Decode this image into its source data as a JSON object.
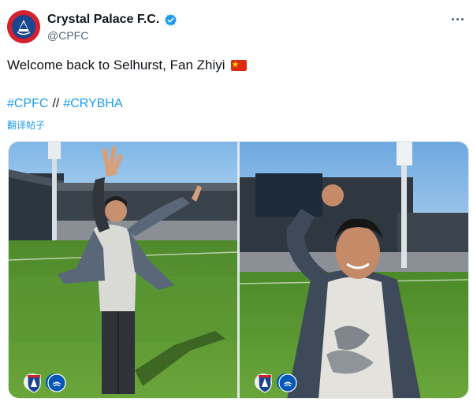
{
  "account": {
    "display_name": "Crystal Palace F.C.",
    "handle": "@CPFC",
    "avatar_icon": "crystal-palace-crest-icon",
    "verified_icon": "verified-badge-icon",
    "verified_color": "#1d9bf0"
  },
  "menu": {
    "more_icon": "more-options-icon"
  },
  "tweet": {
    "text": "Welcome back to Selhurst, Fan Zhiyi",
    "emoji_icon": "china-flag-icon",
    "hashtags": [
      "#CPFC",
      "#CRYBHA"
    ],
    "separator": "//",
    "translate_label": "翻译帖子"
  },
  "media": {
    "photos": [
      {
        "icon": "photo-fan-zhiyi-arms-raised",
        "badges": [
          "crystal-palace-badge-icon",
          "brighton-badge-icon"
        ]
      },
      {
        "icon": "photo-fan-zhiyi-waving",
        "badges": [
          "crystal-palace-badge-icon",
          "brighton-badge-icon"
        ]
      }
    ]
  },
  "colors": {
    "link": "#1d9bf0",
    "text": "#0f1419",
    "secondary": "#536471",
    "palace_red": "#d4212d",
    "palace_blue": "#1b458f"
  }
}
